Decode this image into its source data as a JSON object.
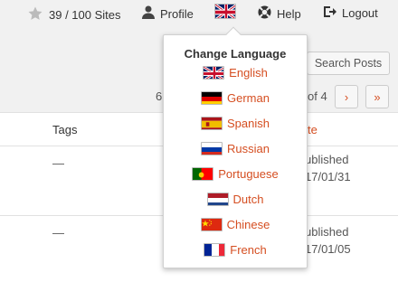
{
  "topbar": {
    "sites_count": "39 / 100 Sites",
    "profile_label": "Profile",
    "help_label": "Help",
    "logout_label": "Logout",
    "current_language_flag": "uk-flag-icon"
  },
  "search": {
    "button_label": "Search Posts"
  },
  "pagination": {
    "partial_left": "6",
    "of_text": "of 4",
    "next_label": "›",
    "last_label": "»"
  },
  "table": {
    "columns": {
      "tags": "Tags",
      "date_partial": "te"
    },
    "rows": [
      {
        "tags": "—",
        "status": "ublished",
        "date": "17/01/31"
      },
      {
        "tags": "—",
        "status": "ublished",
        "date": "17/01/05"
      }
    ]
  },
  "language_menu": {
    "title": "Change Language",
    "languages": [
      {
        "label": "English",
        "icon": "uk-flag-icon"
      },
      {
        "label": "German",
        "icon": "germany-flag-icon"
      },
      {
        "label": "Spanish",
        "icon": "spain-flag-icon"
      },
      {
        "label": "Russian",
        "icon": "russia-flag-icon"
      },
      {
        "label": "Portuguese",
        "icon": "portugal-flag-icon"
      },
      {
        "label": "Dutch",
        "icon": "netherlands-flag-icon"
      },
      {
        "label": "Chinese",
        "icon": "china-flag-icon"
      },
      {
        "label": "French",
        "icon": "france-flag-icon"
      }
    ]
  },
  "colors": {
    "accent": "#d54e21",
    "background": "#f1f1f1"
  }
}
